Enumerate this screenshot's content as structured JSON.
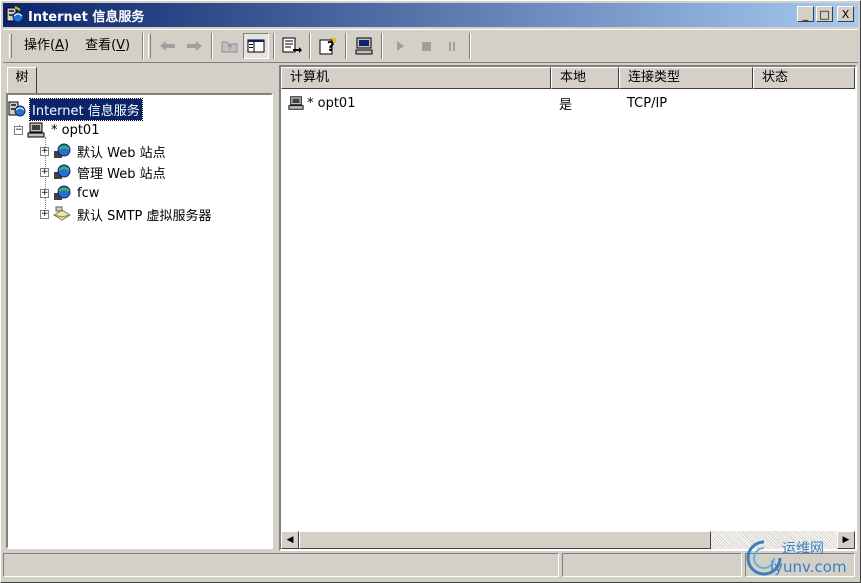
{
  "window": {
    "title": "Internet 信息服务",
    "controls": [
      "_",
      "□",
      "X"
    ]
  },
  "toolbar": {
    "menus": [
      {
        "label": "操作(",
        "key": "A",
        "suffix": ")"
      },
      {
        "label": "查看(",
        "key": "V",
        "suffix": ")"
      }
    ],
    "icons": [
      "back-arrow-icon",
      "forward-arrow-icon",
      "up-folder-icon",
      "show-hide-tree-icon",
      "export-list-icon",
      "help-icon",
      "connect-computer-icon",
      "start-icon",
      "stop-icon",
      "pause-icon"
    ]
  },
  "tree": {
    "tab_label": "树",
    "root": {
      "label": "Internet 信息服务",
      "icon": "iis-icon"
    },
    "computer": {
      "label": "* opt01",
      "icon": "computer-icon",
      "expander": "−"
    },
    "children": [
      {
        "label": "默认 Web 站点",
        "icon": "web-site-globe-icon",
        "expander": "+"
      },
      {
        "label": "管理 Web 站点",
        "icon": "web-site-globe-icon",
        "expander": "+"
      },
      {
        "label": "fcw",
        "icon": "web-site-globe-icon",
        "expander": "+"
      },
      {
        "label": "默认 SMTP 虚拟服务器",
        "icon": "smtp-server-icon",
        "expander": "+"
      }
    ]
  },
  "list": {
    "columns": [
      "计算机",
      "本地",
      "连接类型",
      "状态"
    ],
    "rows": [
      {
        "computer": "* opt01",
        "local": "是",
        "connection": "TCP/IP",
        "status": ""
      }
    ]
  },
  "watermark": {
    "cn": "运维网",
    "en": "iyunv.com"
  },
  "colors": {
    "titlebar_start": "#0a246a",
    "titlebar_end": "#a6caf0",
    "face": "#d4d0c8",
    "selection": "#0a246a"
  }
}
